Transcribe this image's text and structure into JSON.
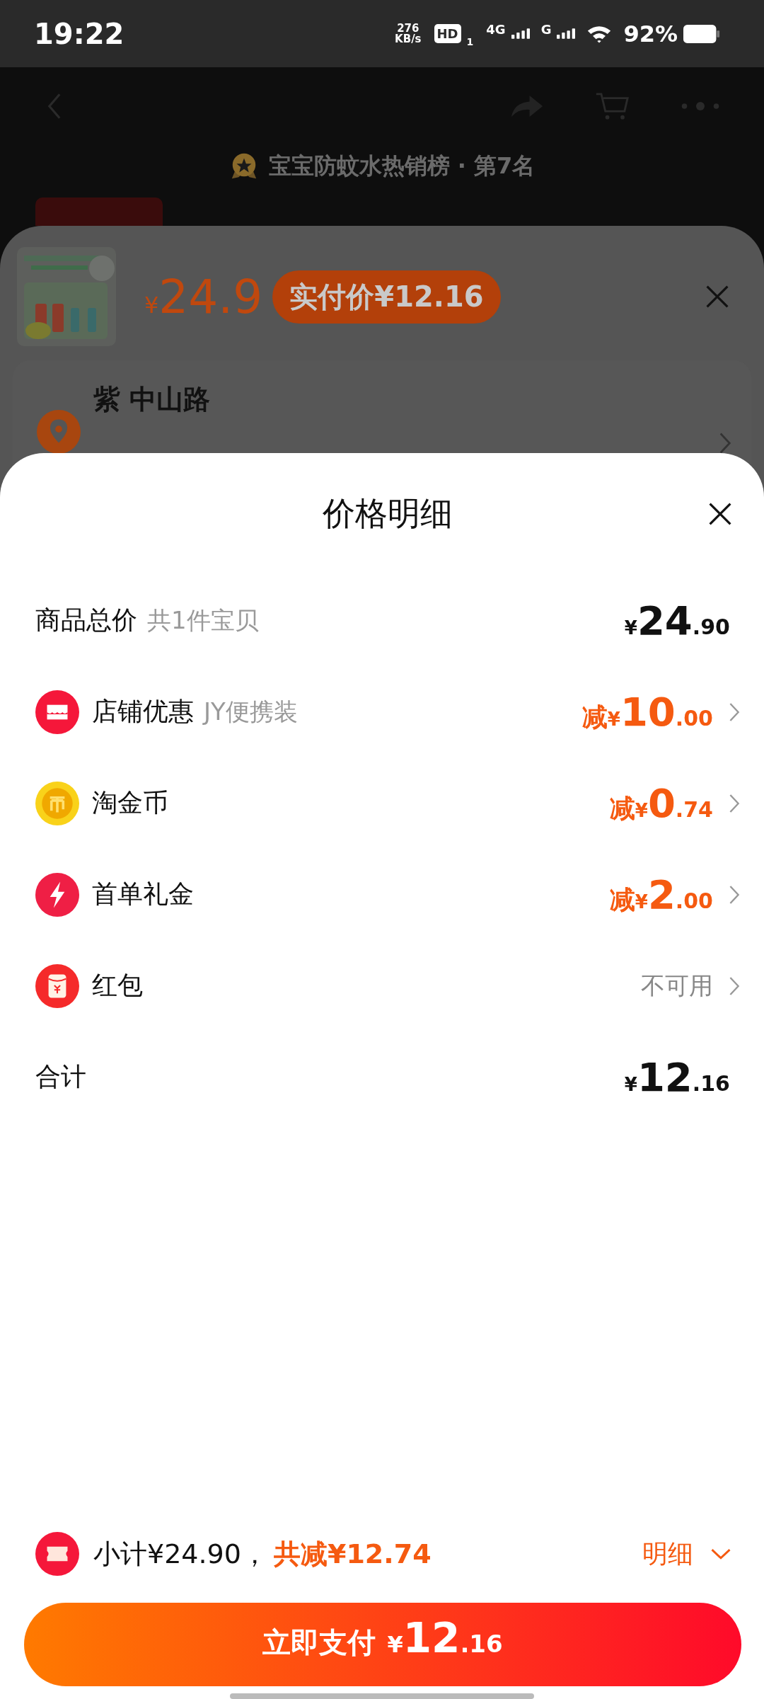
{
  "status_bar": {
    "time": "19:22",
    "speed_value": "276",
    "speed_unit": "KB/s",
    "hd": "HD",
    "sim": "1",
    "net1": "4G",
    "net2": "G",
    "battery": "92%"
  },
  "product_page": {
    "rank": "宝宝防蚊水热销榜 · 第7名"
  },
  "order_sheet": {
    "price_currency": "¥",
    "price": "24.9",
    "paid_badge": "实付价¥12.16",
    "address": "紫 中山路"
  },
  "price_detail": {
    "title": "价格明细",
    "rows": [
      {
        "kind": "total",
        "label": "商品总价",
        "note": "共1件宝贝",
        "prefix": "",
        "currency": "¥",
        "integer": "24",
        "decimals": ".90"
      },
      {
        "kind": "shop",
        "label": "店铺优惠",
        "note": "JY便携装",
        "prefix": "减",
        "currency": "¥",
        "integer": "10",
        "decimals": ".00"
      },
      {
        "kind": "coin",
        "label": "淘金币",
        "prefix": "减",
        "currency": "¥",
        "integer": "0",
        "decimals": ".74"
      },
      {
        "kind": "gift",
        "label": "首单礼金",
        "prefix": "减",
        "currency": "¥",
        "integer": "2",
        "decimals": ".00"
      },
      {
        "kind": "redpacket",
        "label": "红包",
        "status": "不可用"
      },
      {
        "kind": "sum",
        "label": "合计",
        "prefix": "",
        "currency": "¥",
        "integer": "12",
        "decimals": ".16"
      }
    ],
    "summary": {
      "subtotal": "小计¥24.90，",
      "discount": "共减¥12.74",
      "detail_link": "明细"
    },
    "pay_button": {
      "label": "立即支付",
      "currency": "¥",
      "integer": "12",
      "decimals": ".16"
    }
  }
}
